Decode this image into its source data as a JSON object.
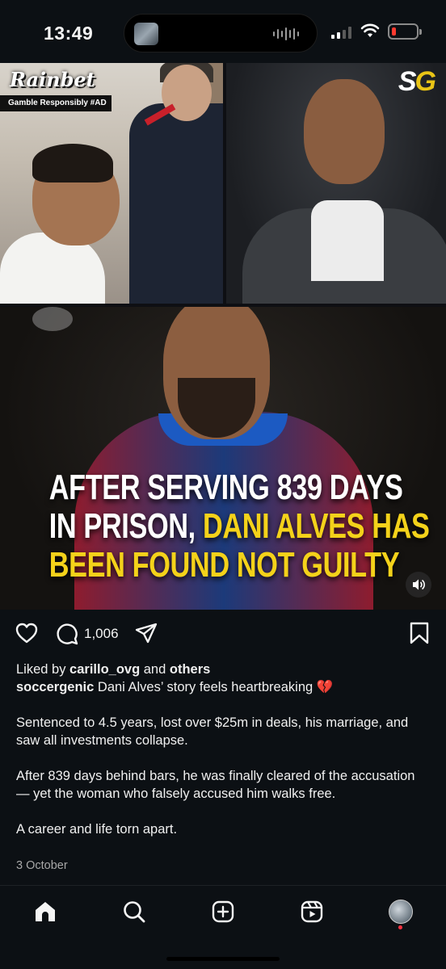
{
  "status_bar": {
    "time": "13:49"
  },
  "post": {
    "sponsor": {
      "logo_text": "Rainbet",
      "note": "Gamble Responsibly #AD"
    },
    "publisher_logo": {
      "first": "S",
      "second": "G"
    },
    "headline": {
      "line1": "AFTER SERVING 839 DAYS",
      "line2_white": "IN PRISON, ",
      "line2_yellow": "DANI ALVES HAS",
      "line3": "BEEN FOUND NOT GUILTY"
    },
    "colors": {
      "headline_white": "#ffffff",
      "headline_yellow": "#f4d21a",
      "background": "#0c1014"
    }
  },
  "actions": {
    "comment_count": "1,006"
  },
  "caption": {
    "liked_prefix": "Liked by ",
    "liked_user": "carillo_ovg",
    "liked_middle": " and ",
    "liked_others": "others",
    "username": "soccergenic",
    "text_line1": " Dani Alves’ story feels heartbreaking 💔",
    "paragraph2": "Sentenced to 4.5 years, lost over $25m in deals, his marriage, and saw all investments collapse.",
    "paragraph3": "After 839 days behind bars, he was finally cleared of the accusation — yet the woman who falsely accused him walks free.",
    "paragraph4": "A career and life torn apart.",
    "date": "3 October"
  },
  "tabbar": {
    "icons": [
      "home-icon",
      "search-icon",
      "create-icon",
      "reels-icon",
      "profile-avatar"
    ]
  }
}
